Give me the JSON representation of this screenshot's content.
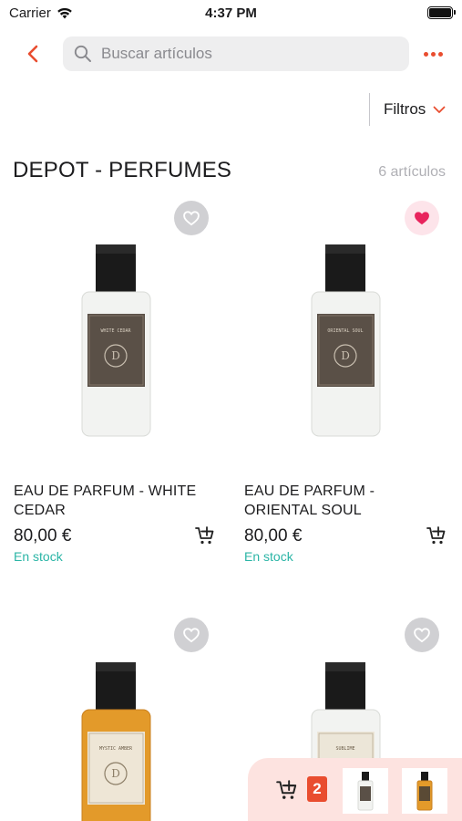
{
  "status": {
    "carrier": "Carrier",
    "time": "4:37 PM"
  },
  "nav": {
    "search_placeholder": "Buscar artículos"
  },
  "filters": {
    "label": "Filtros"
  },
  "section": {
    "title": "DEPOT - PERFUMES",
    "count": "6 artículos"
  },
  "products": [
    {
      "name_line1": "EAU DE PARFUM - WHITE",
      "name_line2": "CEDAR",
      "price": "80,00 €",
      "stock": "En stock",
      "favorite": false,
      "label_text": "WHITE CEDAR",
      "liquid": "clear"
    },
    {
      "name_line1": "EAU DE PARFUM -",
      "name_line2": "ORIENTAL SOUL",
      "price": "80,00 €",
      "stock": "En stock",
      "favorite": true,
      "label_text": "ORIENTAL SOUL",
      "liquid": "clear"
    },
    {
      "favorite": false,
      "label_text": "MYSTIC AMBER",
      "liquid": "amber"
    },
    {
      "favorite": false,
      "label_text": "SUBLIME",
      "liquid": "clear"
    }
  ],
  "mini_cart": {
    "count": "2"
  },
  "colors": {
    "accent": "#e94d2f",
    "stock": "#2bb5a6",
    "favorite": "#e8245d",
    "search_bg": "#eeeeef",
    "mini_cart_bg": "#fde3e0"
  }
}
